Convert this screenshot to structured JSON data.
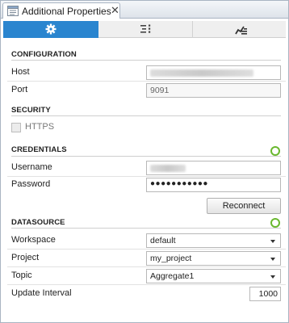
{
  "tab": {
    "title": "Additional Properties",
    "close_glyph": "✕",
    "icon": "properties-icon"
  },
  "toolbar": {
    "items": [
      {
        "icon": "gear-icon",
        "active": true
      },
      {
        "icon": "list-icon",
        "active": false
      },
      {
        "icon": "chart-icon",
        "active": false
      }
    ],
    "accent_color": "#2a85cf"
  },
  "configuration": {
    "header": "CONFIGURATION",
    "host_label": "Host",
    "port_label": "Port",
    "port_value": "9091"
  },
  "security": {
    "header": "SECURITY",
    "https_label": "HTTPS",
    "https_checked": false
  },
  "credentials": {
    "header": "CREDENTIALS",
    "status_color": "#6ab82f",
    "username_label": "Username",
    "password_label": "Password",
    "password_mask": "●●●●●●●●●●●",
    "reconnect_label": "Reconnect"
  },
  "datasource": {
    "header": "DATASOURCE",
    "status_color": "#6ab82f",
    "workspace_label": "Workspace",
    "workspace_value": "default",
    "project_label": "Project",
    "project_value": "my_project",
    "topic_label": "Topic",
    "topic_value": "Aggregate1",
    "update_interval_label": "Update Interval",
    "update_interval_value": "1000"
  }
}
